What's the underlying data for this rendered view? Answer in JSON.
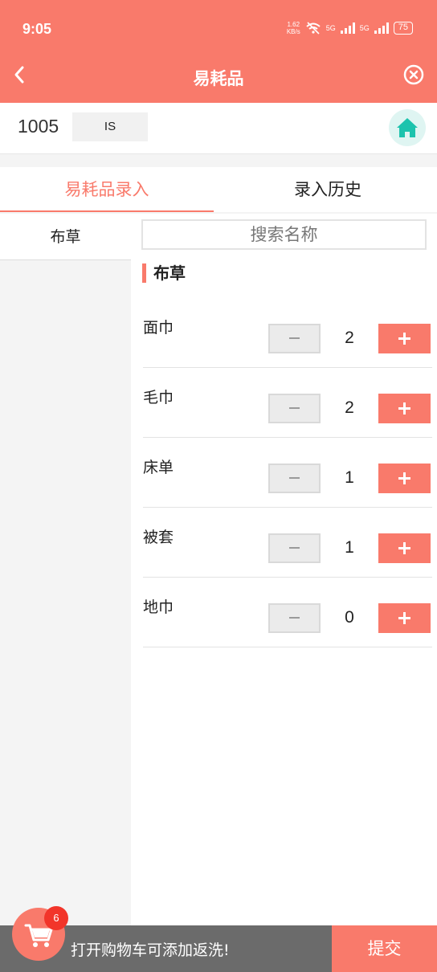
{
  "status_bar": {
    "time": "9:05",
    "net_speed_value": "1.62",
    "net_speed_unit": "KB/s",
    "signal_1": "5G",
    "signal_2": "5G",
    "battery": "75"
  },
  "nav": {
    "title": "易耗品",
    "back_icon": "chevron-left-icon",
    "close_icon": "close-circle-icon"
  },
  "info": {
    "code": "1005",
    "tag": "IS",
    "home_icon": "home-icon"
  },
  "tabs": [
    {
      "label": "易耗品录入",
      "active": true
    },
    {
      "label": "录入历史",
      "active": false
    }
  ],
  "sidebar": {
    "categories": [
      {
        "label": "布草",
        "active": true
      }
    ]
  },
  "search": {
    "placeholder": "搜索名称"
  },
  "section": {
    "title": "布草"
  },
  "items": [
    {
      "name": "面巾",
      "qty": "2"
    },
    {
      "name": "毛巾",
      "qty": "2"
    },
    {
      "name": "床单",
      "qty": "1"
    },
    {
      "name": "被套",
      "qty": "1"
    },
    {
      "name": "地巾",
      "qty": "0"
    }
  ],
  "bottom": {
    "hint": "打开购物车可添加返洗!",
    "submit": "提交",
    "cart_count": "6",
    "cart_icon": "cart-icon"
  },
  "colors": {
    "accent": "#f97a6b",
    "bottom_bar": "#6b6b6b",
    "badge": "#f2352a",
    "home_icon": "#1cc3ad"
  }
}
